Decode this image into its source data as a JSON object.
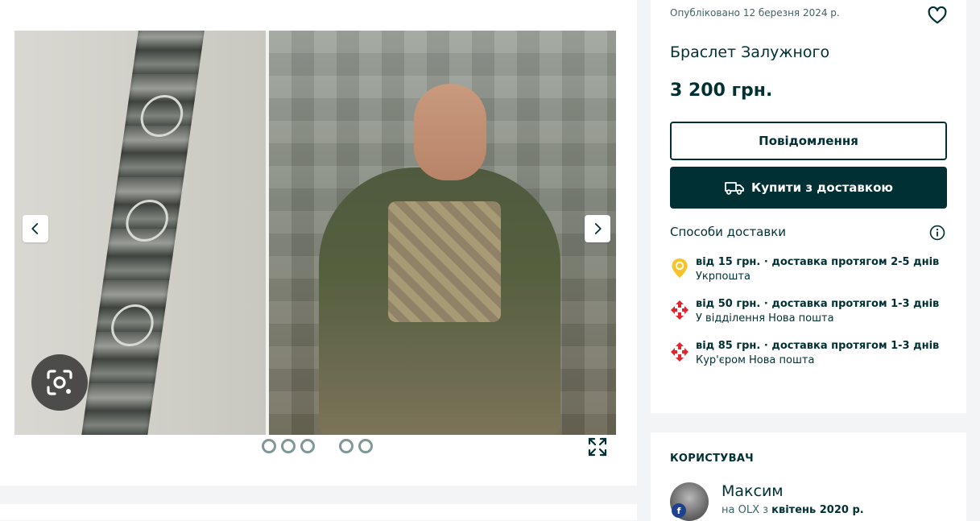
{
  "gallery": {
    "photo_count": 5,
    "active_index": 0
  },
  "listing": {
    "published": "Опубліковано 12 березня 2024 р.",
    "title": "Браслет Залужного",
    "price": "3 200 грн.",
    "message_button": "Повідомлення",
    "buy_button": "Купити з доставкою"
  },
  "delivery": {
    "heading": "Способи доставки",
    "options": [
      {
        "icon": "ukrposhta-pin-icon",
        "main": "від 15 грн. · доставка протягом 2-5 днів",
        "sub": "Укрпошта"
      },
      {
        "icon": "nova-poshta-icon",
        "main": "від 50 грн. · доставка протягом 1-3 днів",
        "sub": "У відділення Нова пошта"
      },
      {
        "icon": "nova-poshta-icon",
        "main": "від 85 грн. · доставка протягом 1-3 днів",
        "sub": "Кур'єром Нова пошта"
      }
    ]
  },
  "user": {
    "heading": "КОРИСТУВАЧ",
    "name": "Максим",
    "since_prefix": "на OLX з ",
    "since_date": "квітень 2020 р."
  },
  "colors": {
    "primary": "#002f34",
    "background": "#f2f4f5",
    "ukrposhta": "#f7c326",
    "nova_poshta": "#e3252b"
  }
}
